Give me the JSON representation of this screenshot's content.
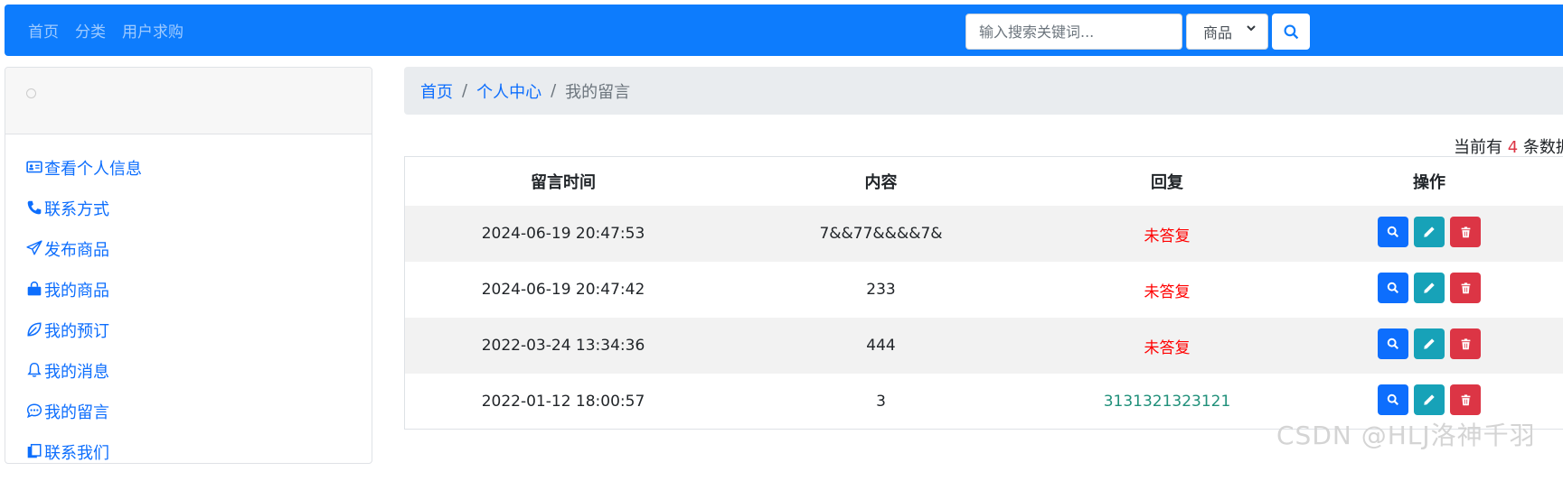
{
  "nav": {
    "links": [
      "首页",
      "分类",
      "用户求购"
    ]
  },
  "search": {
    "placeholder": "输入搜索关键词...",
    "category": "商品",
    "button_icon": "search-icon"
  },
  "sidebar": {
    "items": [
      {
        "label": "查看个人信息",
        "icon": "id-card-icon"
      },
      {
        "label": "联系方式",
        "icon": "telephone-icon"
      },
      {
        "label": "发布商品",
        "icon": "send-icon"
      },
      {
        "label": "我的商品",
        "icon": "bag-icon"
      },
      {
        "label": "我的预订",
        "icon": "leaf-icon"
      },
      {
        "label": "我的消息",
        "icon": "bell-icon"
      },
      {
        "label": "我的留言",
        "icon": "chat-dots-icon"
      },
      {
        "label": "联系我们",
        "icon": "files-icon"
      }
    ]
  },
  "breadcrumb": {
    "home": "首页",
    "center": "个人中心",
    "current": "我的留言",
    "separator": "/"
  },
  "count": {
    "prefix": "当前有",
    "value": "4",
    "suffix": "条数据"
  },
  "table": {
    "headers": [
      "留言时间",
      "内容",
      "回复",
      "操作"
    ],
    "rows": [
      {
        "time": "2024-06-19 20:47:53",
        "content": "7&&77&&&&7&",
        "reply": "未答复",
        "replied": false
      },
      {
        "time": "2024-06-19 20:47:42",
        "content": "233",
        "reply": "未答复",
        "replied": false
      },
      {
        "time": "2022-03-24 13:34:36",
        "content": "444",
        "reply": "未答复",
        "replied": false
      },
      {
        "time": "2022-01-12 18:00:57",
        "content": "3",
        "reply": "3131321323121",
        "replied": true
      }
    ]
  },
  "colors": {
    "primary": "#0d7cfd",
    "info": "#17a2b8",
    "danger": "#dc3545",
    "unreplied": "#ff0000",
    "replied": "#20907a"
  },
  "watermark": "CSDN @HLJ洛神千羽"
}
